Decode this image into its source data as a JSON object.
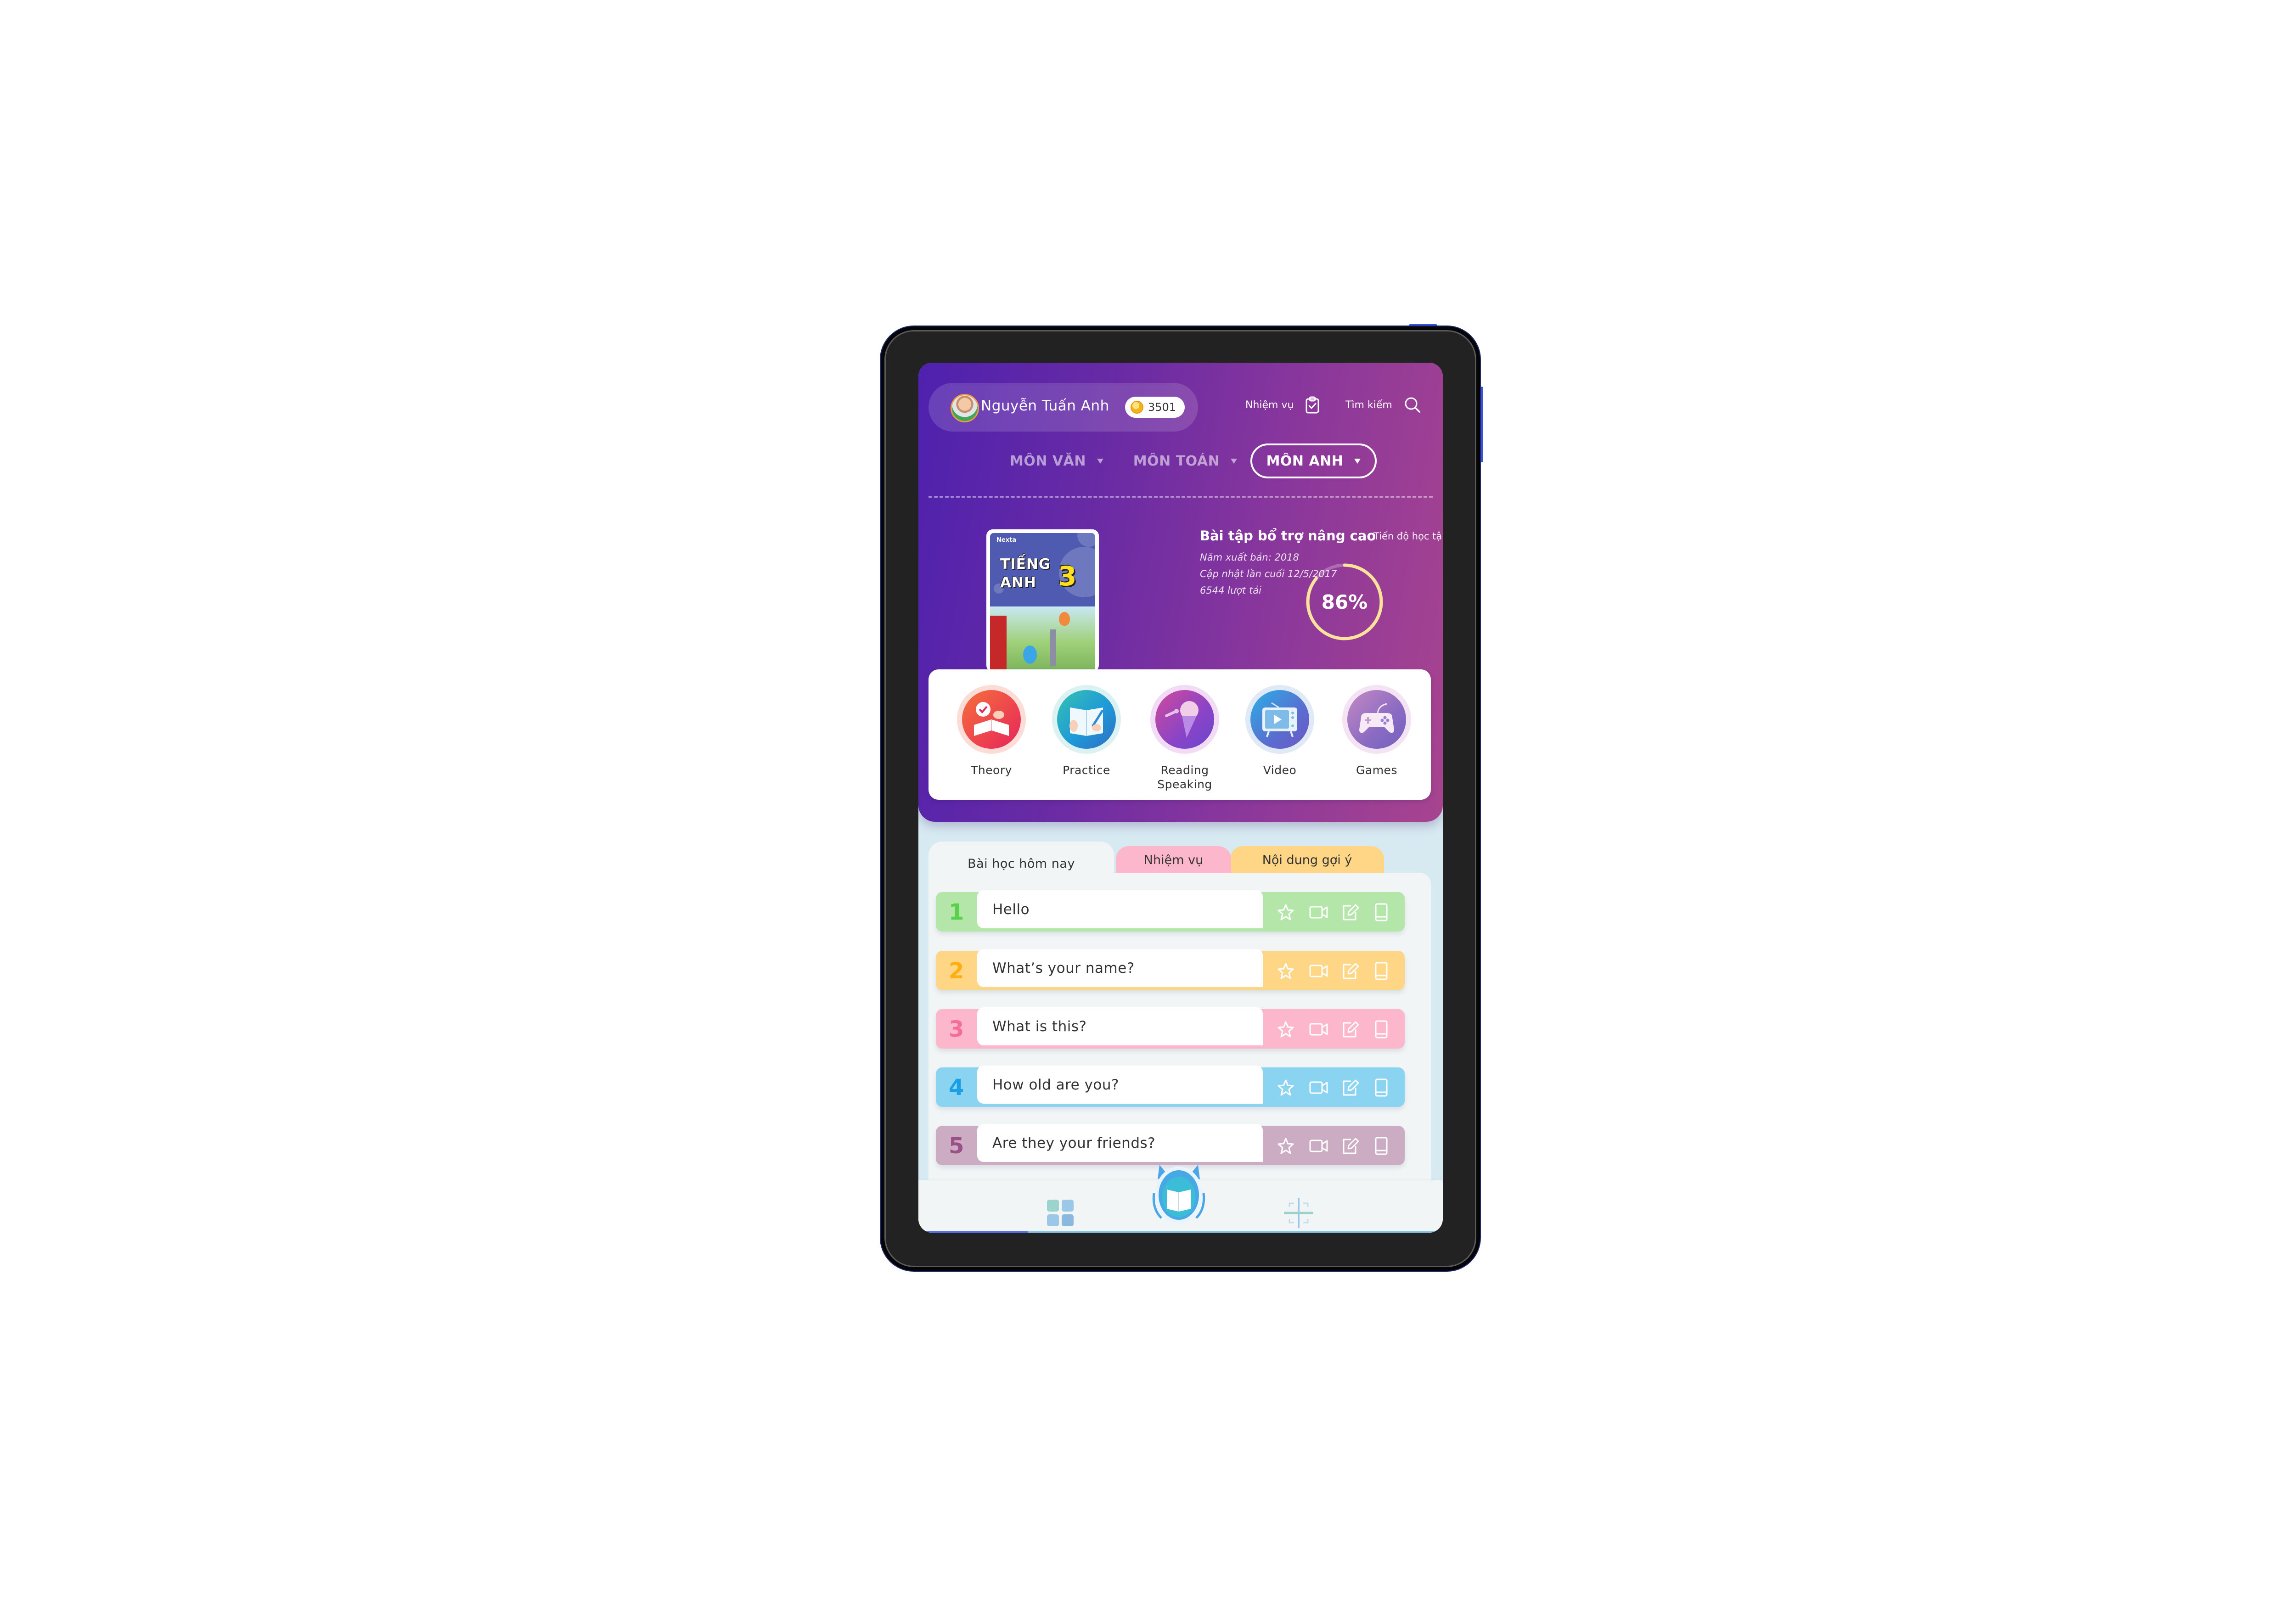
{
  "header": {
    "user": {
      "name": "Nguyễn Tuấn Anh",
      "coins": "3501",
      "avatar_icon": "user-avatar",
      "coin_icon": "coin-icon"
    },
    "links": [
      {
        "label": "Nhiệm vụ",
        "icon": "clipboard-check-icon"
      },
      {
        "label": "Tìm kiếm",
        "icon": "search-icon"
      }
    ],
    "subjects": [
      {
        "label": "MÔN VĂN",
        "active": false
      },
      {
        "label": "MÔN TOÁN",
        "active": false
      },
      {
        "label": "MÔN ANH",
        "active": true
      }
    ]
  },
  "book": {
    "brand": "Nexta",
    "cover_title_line1": "TIẾNG",
    "cover_title_line2": "ANH",
    "cover_grade": "3",
    "title": "Bài tập bổ trợ nâng cao",
    "published": "Năm xuất bản: 2018",
    "updated": "Cập nhật lần cuối 12/5/2017",
    "downloads": "6544 lượt tải",
    "progress_label": "Tiến độ học tập",
    "progress_text": "86%",
    "progress_value": 0.86,
    "progress_color": "#fde29a"
  },
  "features": [
    {
      "label": "Theory",
      "icon": "theory-book-icon"
    },
    {
      "label": "Practice",
      "icon": "practice-notebook-icon"
    },
    {
      "label": "Reading\nSpeaking",
      "label_line1": "Reading",
      "label_line2": "Speaking",
      "icon": "microphone-icon"
    },
    {
      "label": "Video",
      "icon": "tv-play-icon"
    },
    {
      "label": "Games",
      "icon": "gamepad-icon"
    }
  ],
  "lesson_tabs": [
    {
      "label": "Bài học hôm nay",
      "active": true
    },
    {
      "label": "Nhiệm vụ",
      "active": false,
      "color": "#fdb7cc"
    },
    {
      "label": "Nội dung gợi ý",
      "active": false,
      "color": "#fed685"
    }
  ],
  "lessons": [
    {
      "number": "1",
      "title": "Hello",
      "color": "#b3e6a8",
      "num_color": "#5bd04a"
    },
    {
      "number": "2",
      "title": "What’s your name?",
      "color": "#fed685",
      "num_color": "#ffaf10"
    },
    {
      "number": "3",
      "title": "What is this?",
      "color": "#fdb7cc",
      "num_color": "#f56d9a"
    },
    {
      "number": "4",
      "title": "How old are you?",
      "color": "#8ad3f1",
      "num_color": "#1aa0e6"
    },
    {
      "number": "5",
      "title": "Are they your friends?",
      "color": "#ccacc3",
      "num_color": "#9a4f86"
    }
  ],
  "lesson_actions": [
    "star-icon",
    "video-camera-icon",
    "edit-icon",
    "book-icon"
  ],
  "bottom_nav": [
    {
      "icon": "grid-icon"
    },
    {
      "icon": "mascot-book-icon"
    },
    {
      "icon": "scan-icon"
    }
  ]
}
